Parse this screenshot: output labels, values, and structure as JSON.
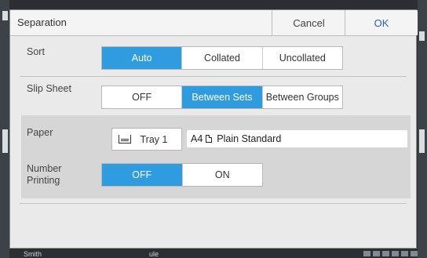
{
  "dialog": {
    "title": "Separation",
    "cancel_label": "Cancel",
    "ok_label": "OK"
  },
  "sort": {
    "label": "Sort",
    "options": [
      "Auto",
      "Collated",
      "Uncollated"
    ],
    "selected": "Auto"
  },
  "slip_sheet": {
    "label": "Slip Sheet",
    "options": [
      "OFF",
      "Between Sets",
      "Between Groups"
    ],
    "selected": "Between Sets"
  },
  "paper": {
    "label": "Paper",
    "tray_label": "Tray 1",
    "size": "A4",
    "type": "Plain Standard"
  },
  "number_printing": {
    "label_line1": "Number",
    "label_line2": "Printing",
    "options": [
      "OFF",
      "ON"
    ],
    "selected": "OFF"
  },
  "background": {
    "text_left": "Smith",
    "text_mid": "ule"
  },
  "colors": {
    "accent": "#2f9ce0",
    "ok_text": "#2a66b0",
    "dialog_bg": "#eaeaea",
    "panel_bg": "#d6d6d6"
  }
}
